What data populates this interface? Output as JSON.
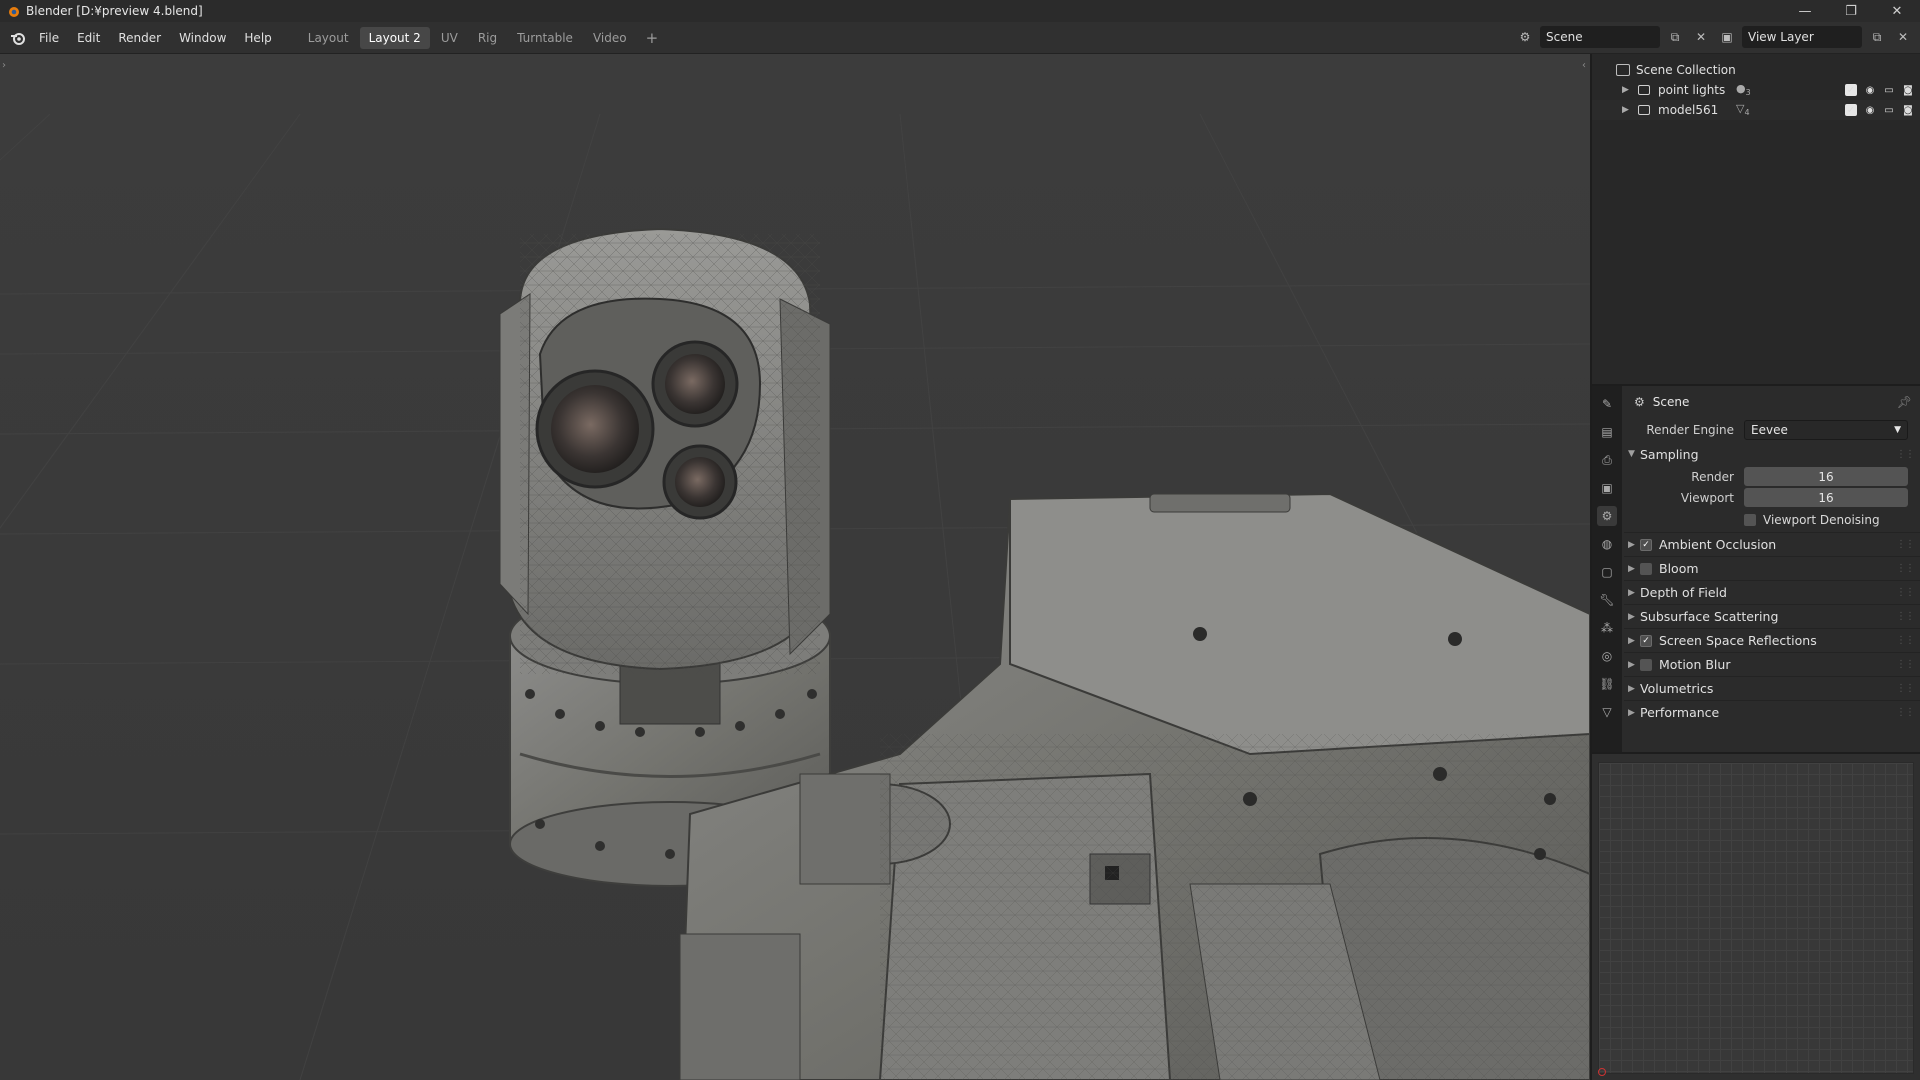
{
  "window": {
    "title": "Blender [D:¥preview 4.blend]",
    "controls": [
      "—",
      "❐",
      "✕"
    ]
  },
  "menu": [
    "File",
    "Edit",
    "Render",
    "Window",
    "Help"
  ],
  "workspaces": {
    "tabs": [
      "Layout",
      "Layout 2",
      "UV",
      "Rig",
      "Turntable",
      "Video"
    ],
    "active": "Layout 2",
    "add": "+"
  },
  "header": {
    "scene": "Scene",
    "view_layer": "View Layer"
  },
  "outliner": {
    "root": "Scene Collection",
    "items": [
      {
        "label": "point lights",
        "badge": "3"
      },
      {
        "label": "model561",
        "badge": "4"
      }
    ]
  },
  "properties": {
    "context": "Scene",
    "render_engine_label": "Render Engine",
    "render_engine": "Eevee",
    "sampling": {
      "title": "Sampling",
      "render_label": "Render",
      "render_value": "16",
      "viewport_label": "Viewport",
      "viewport_value": "16",
      "denoise_label": "Viewport Denoising"
    },
    "panels": [
      {
        "label": "Ambient Occlusion",
        "checkbox": true,
        "checked": true
      },
      {
        "label": "Bloom",
        "checkbox": true,
        "checked": false
      },
      {
        "label": "Depth of Field",
        "checkbox": false
      },
      {
        "label": "Subsurface Scattering",
        "checkbox": false
      },
      {
        "label": "Screen Space Reflections",
        "checkbox": true,
        "checked": true
      },
      {
        "label": "Motion Blur",
        "checkbox": true,
        "checked": false
      },
      {
        "label": "Volumetrics",
        "checkbox": false
      },
      {
        "label": "Performance",
        "checkbox": false
      }
    ]
  },
  "colors": {
    "accent": "#474747",
    "viewport_bg": "#3a3a3a",
    "panel_bg": "#2b2b2b"
  }
}
